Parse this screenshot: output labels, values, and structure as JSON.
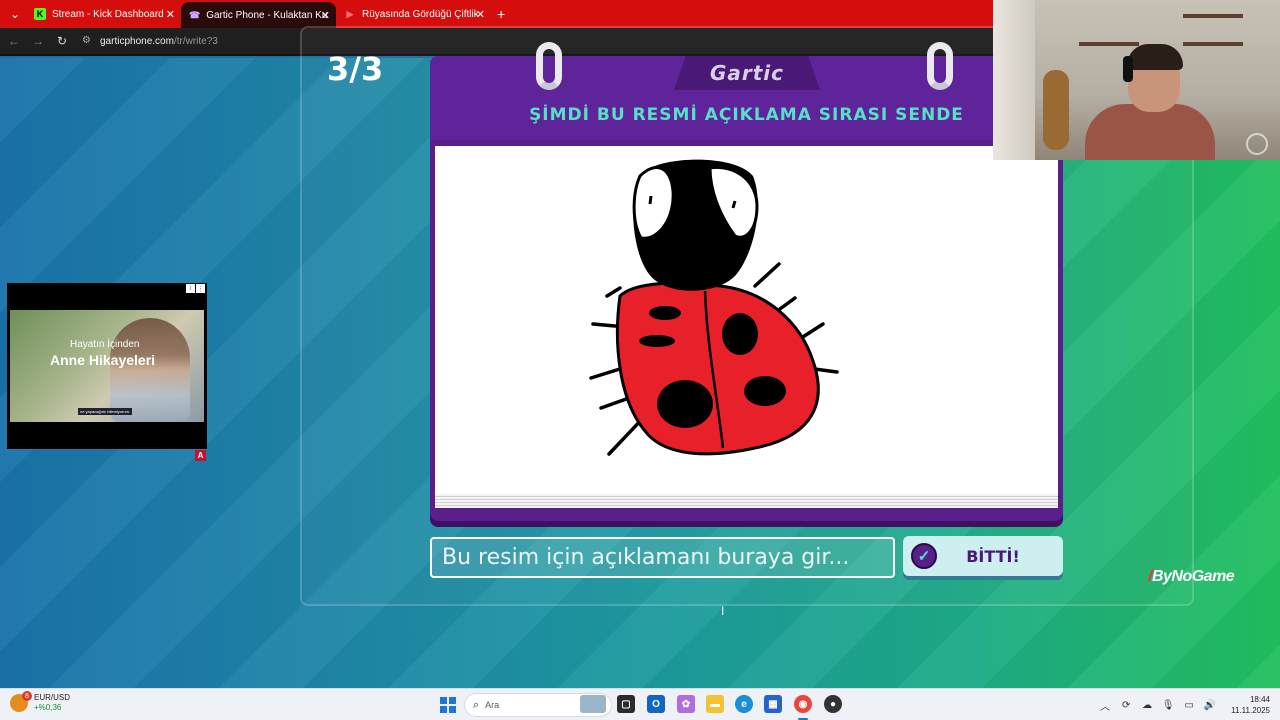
{
  "browser": {
    "tabs": [
      {
        "title": "Stream - Kick Dashboard",
        "favicon": "K",
        "favicon_color": "#53fc18",
        "active": false
      },
      {
        "title": "Gartic Phone - Kulaktan Kulağa",
        "favicon": "☎",
        "favicon_color": "#7b3fe4",
        "active": true
      },
      {
        "title": "Rüyasında Gördüğü Çiftlikte Ci",
        "favicon": "▶",
        "favicon_color": "#d60d0d",
        "active": false
      }
    ],
    "close_glyph": "✕",
    "new_tab_glyph": "+",
    "url_host": "garticphone.com",
    "url_path": "/tr/write?3"
  },
  "game": {
    "round": "3/3",
    "logo": "Gartic",
    "instruction": "ŞİMDİ BU RESMİ AÇIKLAMA SIRASI SENDE",
    "input_placeholder": "Bu resim için açıklamanı buraya gir...",
    "done_label": "BİTTİ!",
    "drawing_subject": "ladybug",
    "colors": {
      "accent": "#57e0c8",
      "card": "#5b1f8c",
      "ladybug_red": "#e8202a"
    }
  },
  "ad": {
    "line1": "Hayatın İçinden",
    "line2": "Anne Hikayeleri",
    "caption": "ne yapacağımı bilemiyorum.",
    "badge": "A"
  },
  "watermark": {
    "mark": "/",
    "text": "ByNoGame"
  },
  "taskbar": {
    "widget_title": "EUR/USD",
    "widget_change": "+%0,36",
    "widget_badge": "8",
    "search_placeholder": "Ara",
    "time": "18:44",
    "date": "11.11.2025"
  }
}
